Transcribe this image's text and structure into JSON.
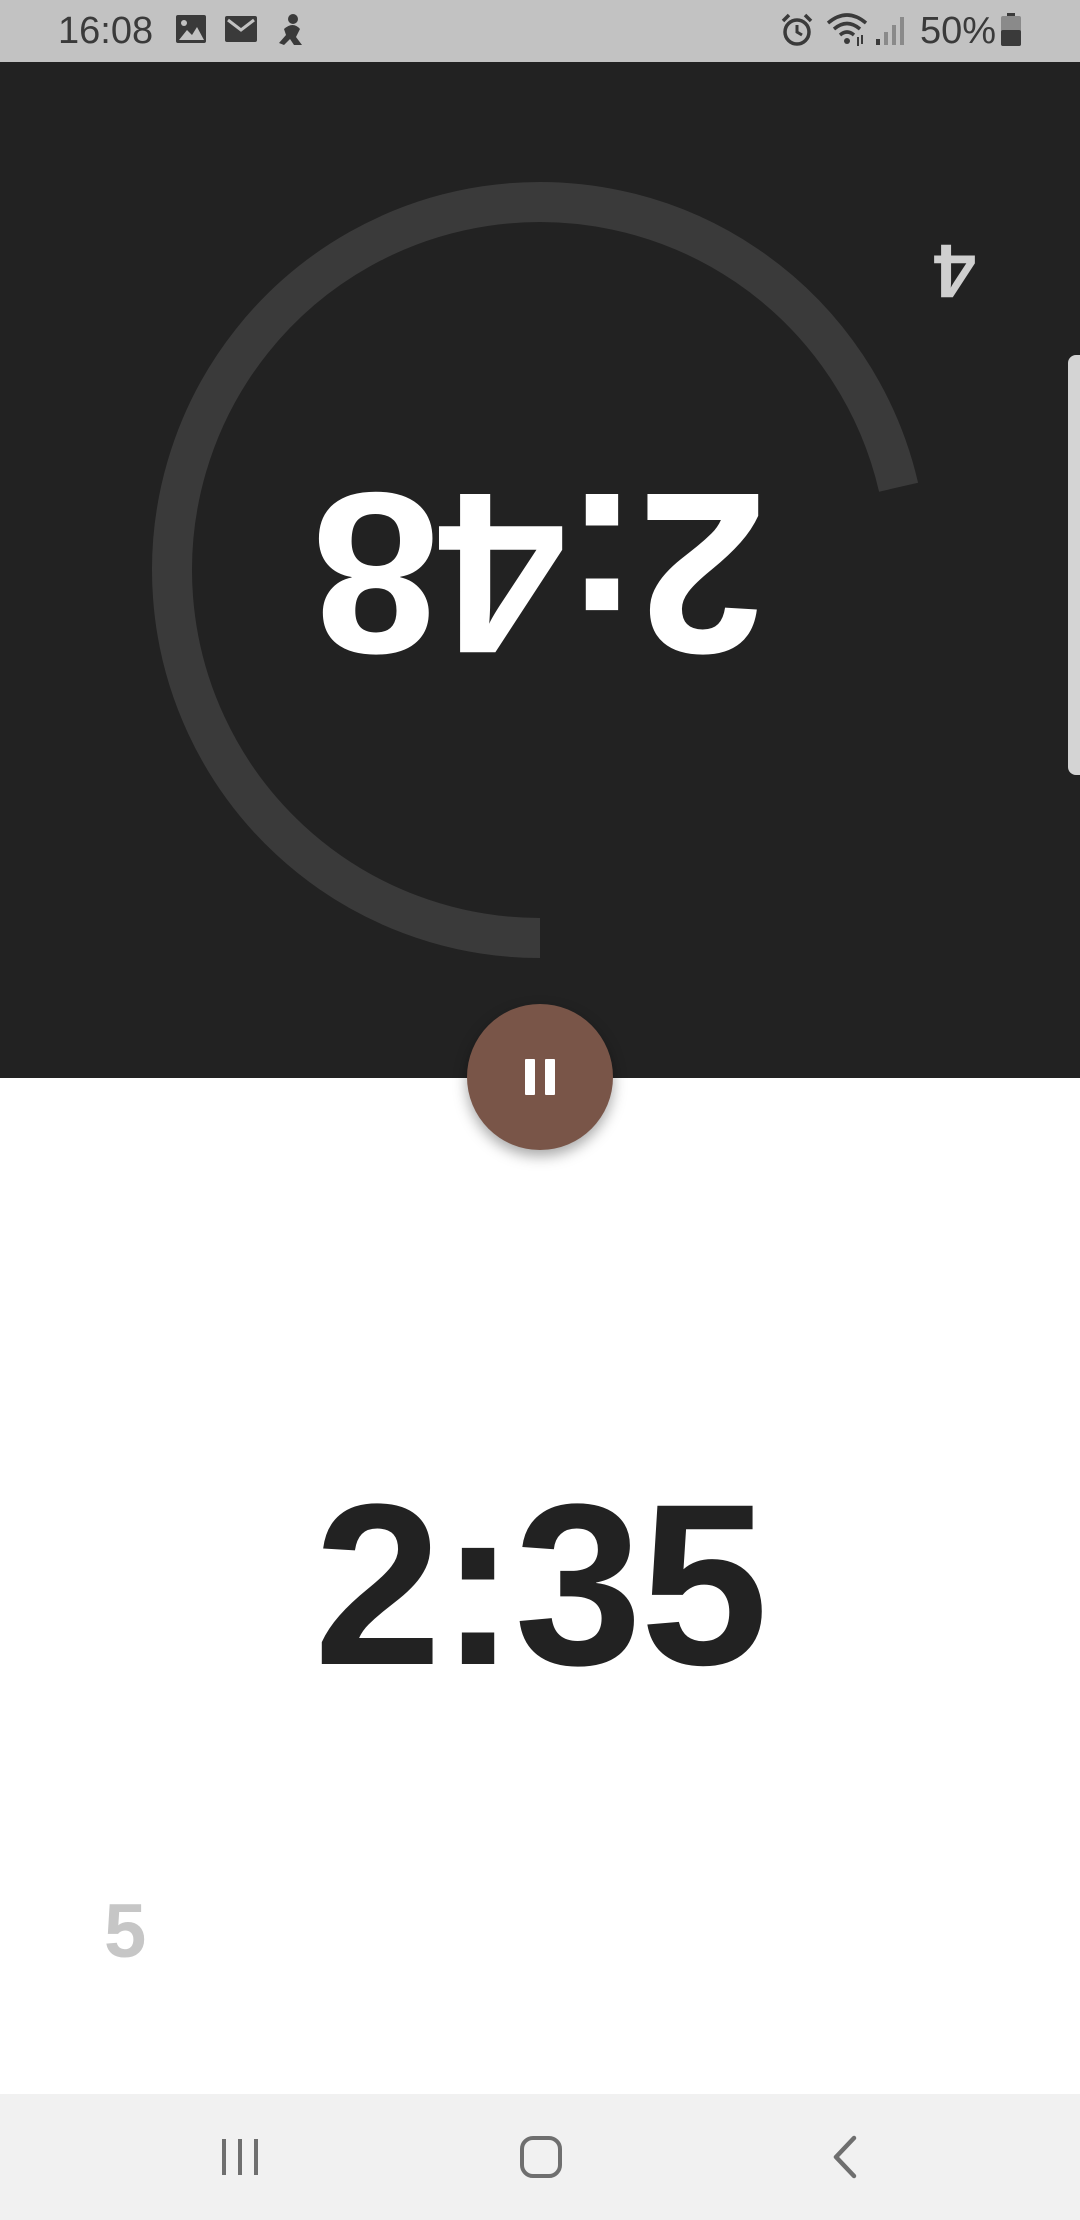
{
  "status_bar": {
    "time": "16:08",
    "icons": [
      "image-icon",
      "mail-icon",
      "notification-figure-icon",
      "alarm-icon",
      "wifi-icon",
      "signal-icon",
      "battery-icon"
    ],
    "battery_text": "50%"
  },
  "opponent_clock": {
    "time": "2:48",
    "move_count": "4",
    "progress_arc_color": "#3a3a3a",
    "panel_color": "#222222"
  },
  "player_clock": {
    "time": "2:35",
    "move_count": "5",
    "panel_color": "#ffffff"
  },
  "controls": {
    "pause_icon": "pause-icon",
    "pause_color": "#795548"
  },
  "nav_bar": {
    "recents_icon": "recents-icon",
    "home_icon": "home-icon",
    "back_icon": "back-icon"
  }
}
